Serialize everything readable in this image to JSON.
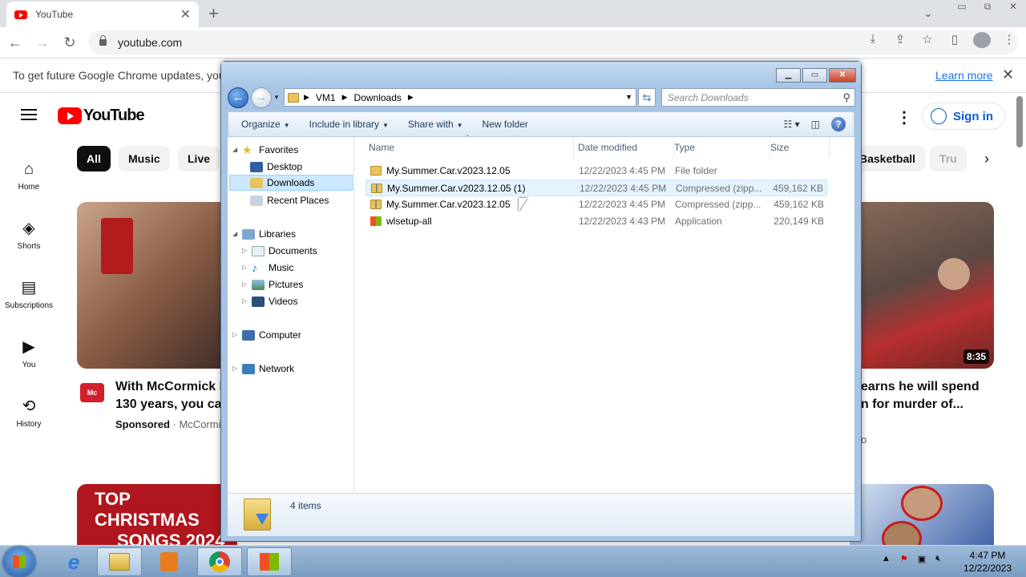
{
  "chrome": {
    "tab_title": "YouTube",
    "url": "youtube.com",
    "infobar_text": "To get future Google Chrome updates, you'll",
    "learn_more": "Learn more"
  },
  "youtube": {
    "logo_text": "YouTube",
    "sign_in": "Sign in",
    "sidebar": [
      {
        "label": "Home",
        "icon": "home-icon"
      },
      {
        "label": "Shorts",
        "icon": "shorts-icon"
      },
      {
        "label": "Subscriptions",
        "icon": "subscriptions-icon"
      },
      {
        "label": "You",
        "icon": "you-icon"
      },
      {
        "label": "History",
        "icon": "history-icon"
      }
    ],
    "chips": [
      "All",
      "Music",
      "Live",
      "Basketball",
      "Tru"
    ],
    "videos": [
      {
        "title_line1": "With McCormick b",
        "title_line2": "130 years, you can",
        "sponsored": "Sponsored",
        "channel": "· McCormi"
      },
      {
        "title_line1": "earns he will spend",
        "title_line2": "n for murder of...",
        "channel_tail": "o",
        "duration": "8:35"
      }
    ],
    "banner_text_1": "TOP CHRISTMAS",
    "banner_text_2": "SONGS 2024"
  },
  "explorer": {
    "path": [
      "VM1",
      "Downloads"
    ],
    "search_placeholder": "Search Downloads",
    "commands": [
      "Organize",
      "Include in library",
      "Share with",
      "New folder"
    ],
    "nav": {
      "favorites": "Favorites",
      "desktop": "Desktop",
      "downloads": "Downloads",
      "recent": "Recent Places",
      "libraries": "Libraries",
      "documents": "Documents",
      "music": "Music",
      "pictures": "Pictures",
      "videos": "Videos",
      "computer": "Computer",
      "network": "Network"
    },
    "columns": {
      "name": "Name",
      "date": "Date modified",
      "type": "Type",
      "size": "Size"
    },
    "files": [
      {
        "name": "My.Summer.Car.v2023.12.05",
        "date": "12/22/2023 4:45 PM",
        "type": "File folder",
        "size": ""
      },
      {
        "name": "My.Summer.Car.v2023.12.05 (1)",
        "date": "12/22/2023 4:45 PM",
        "type": "Compressed (zipp...",
        "size": "459,162 KB"
      },
      {
        "name": "My.Summer.Car.v2023.12.05",
        "date": "12/22/2023 4:45 PM",
        "type": "Compressed (zipp...",
        "size": "459,162 KB"
      },
      {
        "name": "wlsetup-all",
        "date": "12/22/2023 4:43 PM",
        "type": "Application",
        "size": "220,149 KB"
      }
    ],
    "status": "4 items"
  },
  "taskbar": {
    "time": "4:47 PM",
    "date": "12/22/2023"
  }
}
